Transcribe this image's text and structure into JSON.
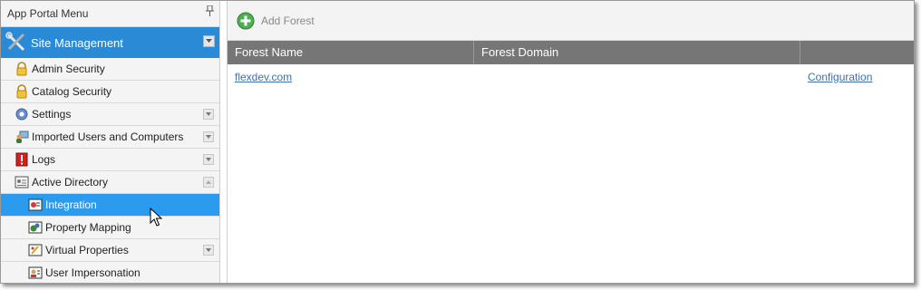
{
  "sidebar": {
    "title": "App Portal Menu",
    "pin_icon": "pin-icon",
    "group": {
      "label": "Site Management",
      "icon": "tools-icon"
    },
    "items": [
      {
        "label": "Admin Security",
        "icon": "lock-icon"
      },
      {
        "label": "Catalog Security",
        "icon": "lock-icon"
      },
      {
        "label": "Settings",
        "icon": "gear-icon"
      },
      {
        "label": "Imported Users and Computers",
        "icon": "users-computer-icon"
      },
      {
        "label": "Logs",
        "icon": "log-alert-icon"
      },
      {
        "label": "Active Directory",
        "icon": "directory-icon"
      },
      {
        "label": "Integration",
        "icon": "integration-icon"
      },
      {
        "label": "Property Mapping",
        "icon": "property-mapping-icon"
      },
      {
        "label": "Virtual Properties",
        "icon": "virtual-properties-icon"
      },
      {
        "label": "User Impersonation",
        "icon": "user-impersonation-icon"
      }
    ],
    "selected": "Integration"
  },
  "toolbar": {
    "add_label": "Add Forest"
  },
  "grid": {
    "columns": [
      "Forest Name",
      "Forest Domain",
      ""
    ],
    "rows": [
      {
        "name": "flexdev.com",
        "domain": "",
        "action": "Configuration"
      }
    ]
  },
  "colors": {
    "accent": "#2b8ad5",
    "selected": "#2b9bf0",
    "header_gray": "#767676",
    "link": "#3d6fb0"
  }
}
